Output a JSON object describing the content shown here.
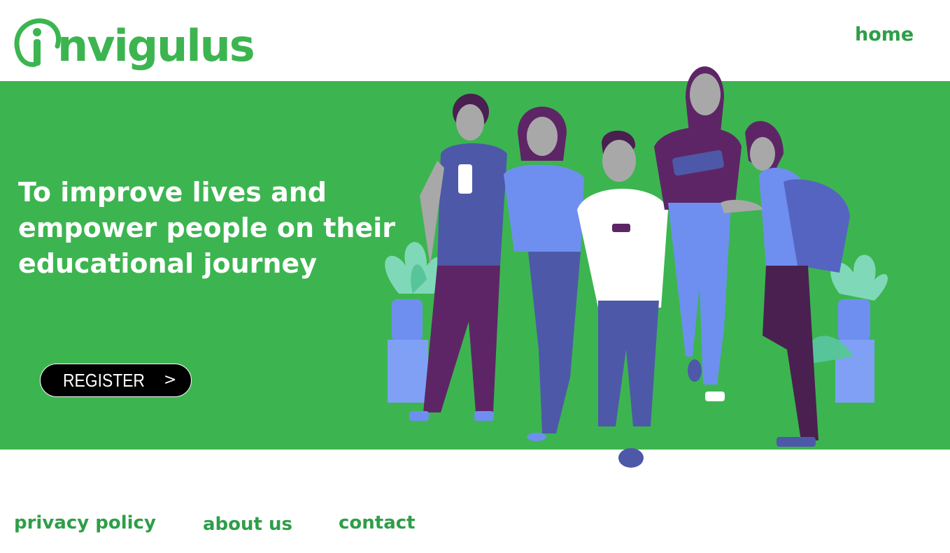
{
  "header": {
    "logo_text": "nvigulus",
    "nav": {
      "home_label": "home"
    }
  },
  "hero": {
    "headline": "To improve lives and empower people on their educational journey",
    "register_button": {
      "label": "REGISTER",
      "arrow": ">"
    }
  },
  "footer": {
    "links": [
      {
        "label": "privacy policy"
      },
      {
        "label": "about us"
      },
      {
        "label": "contact"
      }
    ]
  },
  "colors": {
    "brand_green": "#3cb550",
    "link_green": "#2e9e48",
    "button_bg": "#000000",
    "illustration_purple": "#5e2566",
    "illustration_blue": "#6e8ff0",
    "illustration_indigo": "#4e58a8"
  },
  "icons": {
    "logo": "invigulus-logo-icon",
    "register_arrow": "chevron-right-icon"
  }
}
